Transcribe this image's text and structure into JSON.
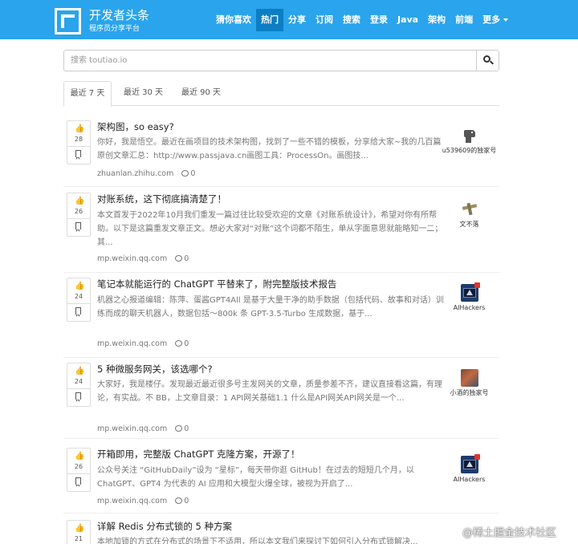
{
  "header": {
    "brand_title": "开发者头条",
    "brand_subtitle": "程序员分享平台",
    "nav": [
      {
        "label": "猜你喜欢"
      },
      {
        "label": "热门",
        "active": true
      },
      {
        "label": "分享"
      },
      {
        "label": "订阅"
      },
      {
        "label": "搜索"
      },
      {
        "label": "登录"
      },
      {
        "label": "Java"
      },
      {
        "label": "架构"
      },
      {
        "label": "前端"
      },
      {
        "label": "更多"
      }
    ]
  },
  "search": {
    "placeholder": "搜索 toutiao.io",
    "value": ""
  },
  "tabs": [
    {
      "label": "最近 7 天",
      "active": true
    },
    {
      "label": "最近 30 天"
    },
    {
      "label": "最近 90 天"
    }
  ],
  "posts": [
    {
      "votes": "28",
      "title": "架构图，so easy?",
      "summary": "你好，我是悟空。最近在画项目的技术架构图，找到了一些不错的模板，分享给大家~我的几百篇原创文章汇总：http://www.passjava.cn画图工具：ProcessOn。画图技...",
      "source": "zhuanlan.zhihu.com",
      "comments": "0",
      "author": "u539609的独家号",
      "avatar_icon": "dinosaur-avatar"
    },
    {
      "votes": "26",
      "title": "对账系统，这下彻底搞清楚了！",
      "summary": "本文首发于2022年10月我们重发一篇过往比较受欢迎的文章《对账系统设计》，希望对你有所帮助。以下是这篇重发文章正文。想必大家对“对账”这个词都不陌生，单从字面意思就能略知一二；其...",
      "source": "mp.weixin.qq.com",
      "comments": "0",
      "author": "文不落",
      "avatar_icon": "plane-avatar"
    },
    {
      "votes": "24",
      "title": "笔记本就能运行的 ChatGPT 平替来了，附完整版技术报告",
      "summary": "机器之心报道编辑：陈萍、蛋酱GPT4All 是基于大量干净的助手数据（包括代码、故事和对话）训练而成的聊天机器人，数据包括～800k 条 GPT-3.5-Turbo 生成数据，基于...",
      "source": "mp.weixin.qq.com",
      "comments": "0",
      "author": "AIHackers",
      "avatar_icon": "aihackers-avatar"
    },
    {
      "votes": "24",
      "title": "5 种微服务网关，该选哪个?",
      "summary": "大家好，我是楼仔。发现最近最近很多号主发网关的文章，质量参差不齐，建议直接看这篇，有理论，有实战。不 BB，上文章目录：1 API网关基础1.1 什么是API网关API网关是一个...",
      "source": "mp.weixin.qq.com",
      "comments": "0",
      "author": "小酒的独家号",
      "avatar_icon": "photo-avatar"
    },
    {
      "votes": "26",
      "title": "开箱即用，完整版 ChatGPT 克隆方案，开源了！",
      "summary": "公众号关注 “GitHubDaily”设为 “星标”，每天带你逛 GitHub！在过去的短短几个月，以 ChatGPT、GPT4 为代表的 AI 应用和大模型火爆全球，被视为开启了...",
      "source": "mp.weixin.qq.com",
      "comments": "0",
      "author": "AIHackers",
      "avatar_icon": "aihackers-avatar"
    },
    {
      "votes": "21",
      "title": "详解 Redis 分布式锁的 5 种方案",
      "summary": "本地加锁的方式在分布式的场景下不适用，所以本文我们来探讨下如何引入分布式锁解决...",
      "source": "",
      "comments": "",
      "author": "",
      "avatar_icon": ""
    }
  ],
  "watermark": "@稀土掘金技术社区"
}
